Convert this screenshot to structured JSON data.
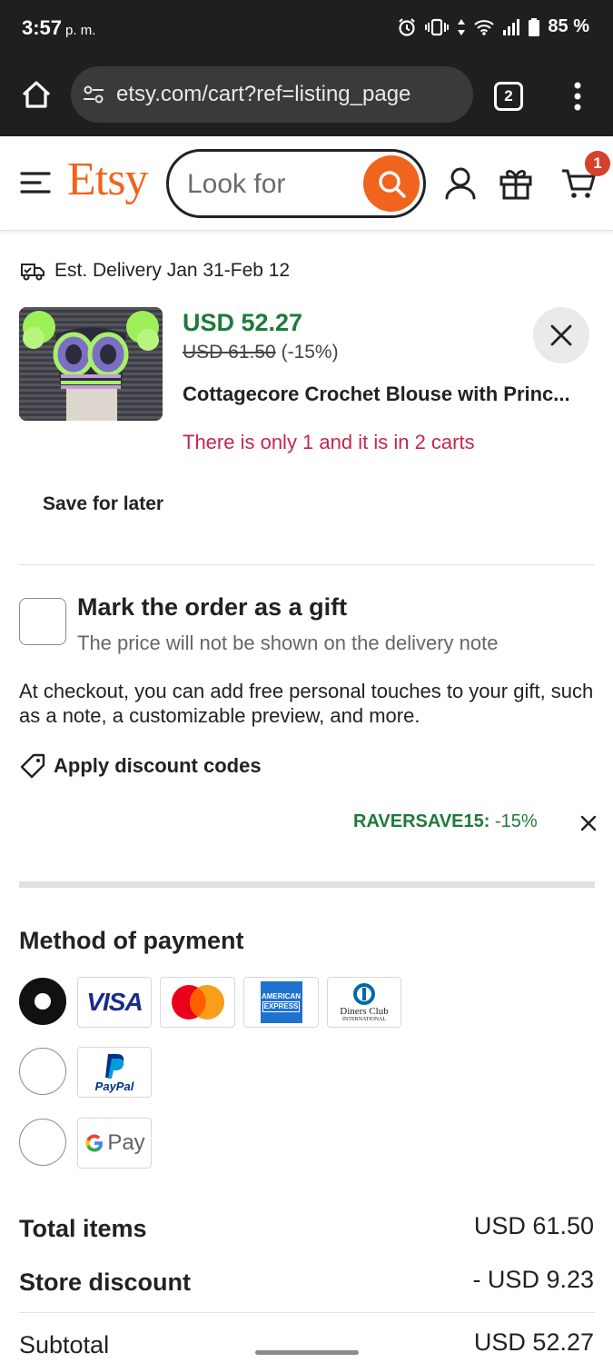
{
  "status_bar": {
    "time": "3:57",
    "ampm": "p. m.",
    "battery": "85 %"
  },
  "browser": {
    "url": "etsy.com/cart?ref=listing_page",
    "tab_count": "2"
  },
  "header": {
    "logo": "Etsy",
    "search_placeholder": "Look for",
    "cart_count": "1"
  },
  "cart_item": {
    "delivery": "Est. Delivery Jan 31-Feb 12",
    "price": "USD 52.27",
    "original_price": "USD 61.50",
    "discount_pct": "(-15%)",
    "title": "Cottagecore Crochet Blouse with Princ...",
    "stock_note": "There is only 1 and it is in 2 carts",
    "save_for_later": "Save for later"
  },
  "gift": {
    "title": "Mark the order as a gift",
    "subtitle": "The price will not be shown on the delivery note",
    "description": "At checkout, you can add free personal touches to your gift, such as a note, a customizable preview, and more."
  },
  "discount": {
    "link_label": "Apply discount codes",
    "code": "RAVERSAVE15:",
    "amount": "-15%"
  },
  "payment": {
    "title": "Method of payment",
    "card_logos": [
      "VISA",
      "Mastercard",
      "AMERICAN EXPRESS",
      "Diners Club INTERNATIONAL"
    ],
    "amex_line1": "AMERICAN",
    "amex_line2": "EXPRESS",
    "diners_line1": "Diners Club",
    "diners_line2": "INTERNATIONAL",
    "paypal_label": "PayPal",
    "gpay_label": "Pay"
  },
  "summary": {
    "total_items_label": "Total items",
    "total_items_value": "USD 61.50",
    "store_discount_label": "Store discount",
    "store_discount_value": "- USD 9.23",
    "subtotal_label": "Subtotal",
    "subtotal_value": "USD 52.27"
  },
  "colors": {
    "etsy_orange": "#f1641e",
    "price_green": "#1e7a3c",
    "alert_red": "#c7254e",
    "cart_badge": "#d5412e"
  }
}
